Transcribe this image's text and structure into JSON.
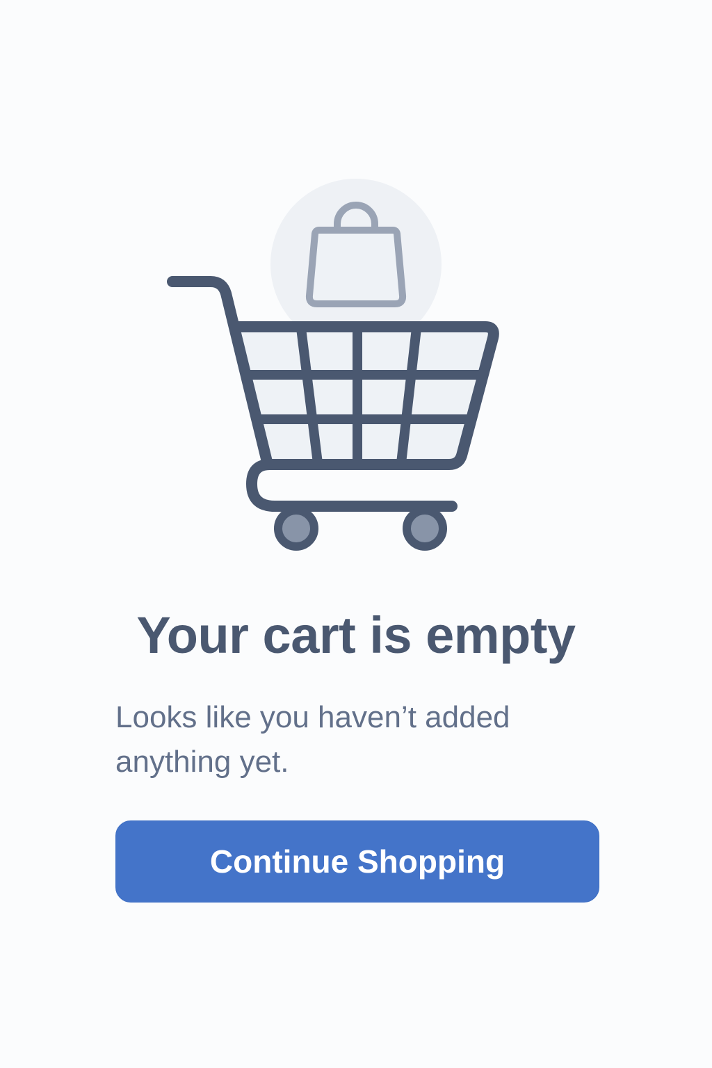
{
  "empty_state": {
    "illustration_icon": "shopping-cart-with-bag-icon",
    "title": "Your cart is empty",
    "message": "Looks like you haven’t added anything yet.",
    "primary_button_label": "Continue Shopping"
  },
  "colors": {
    "background": "#fbfcfd",
    "cart_stroke": "#4a5870",
    "cart_fill": "#eef2f6",
    "bag_circle": "#eef1f5",
    "bag_stroke": "#9aa4b5",
    "wheel_hub": "#8894a8",
    "title_text": "#4a5870",
    "body_text": "#62708a",
    "button_bg": "#4474c9",
    "button_text": "#ffffff"
  }
}
